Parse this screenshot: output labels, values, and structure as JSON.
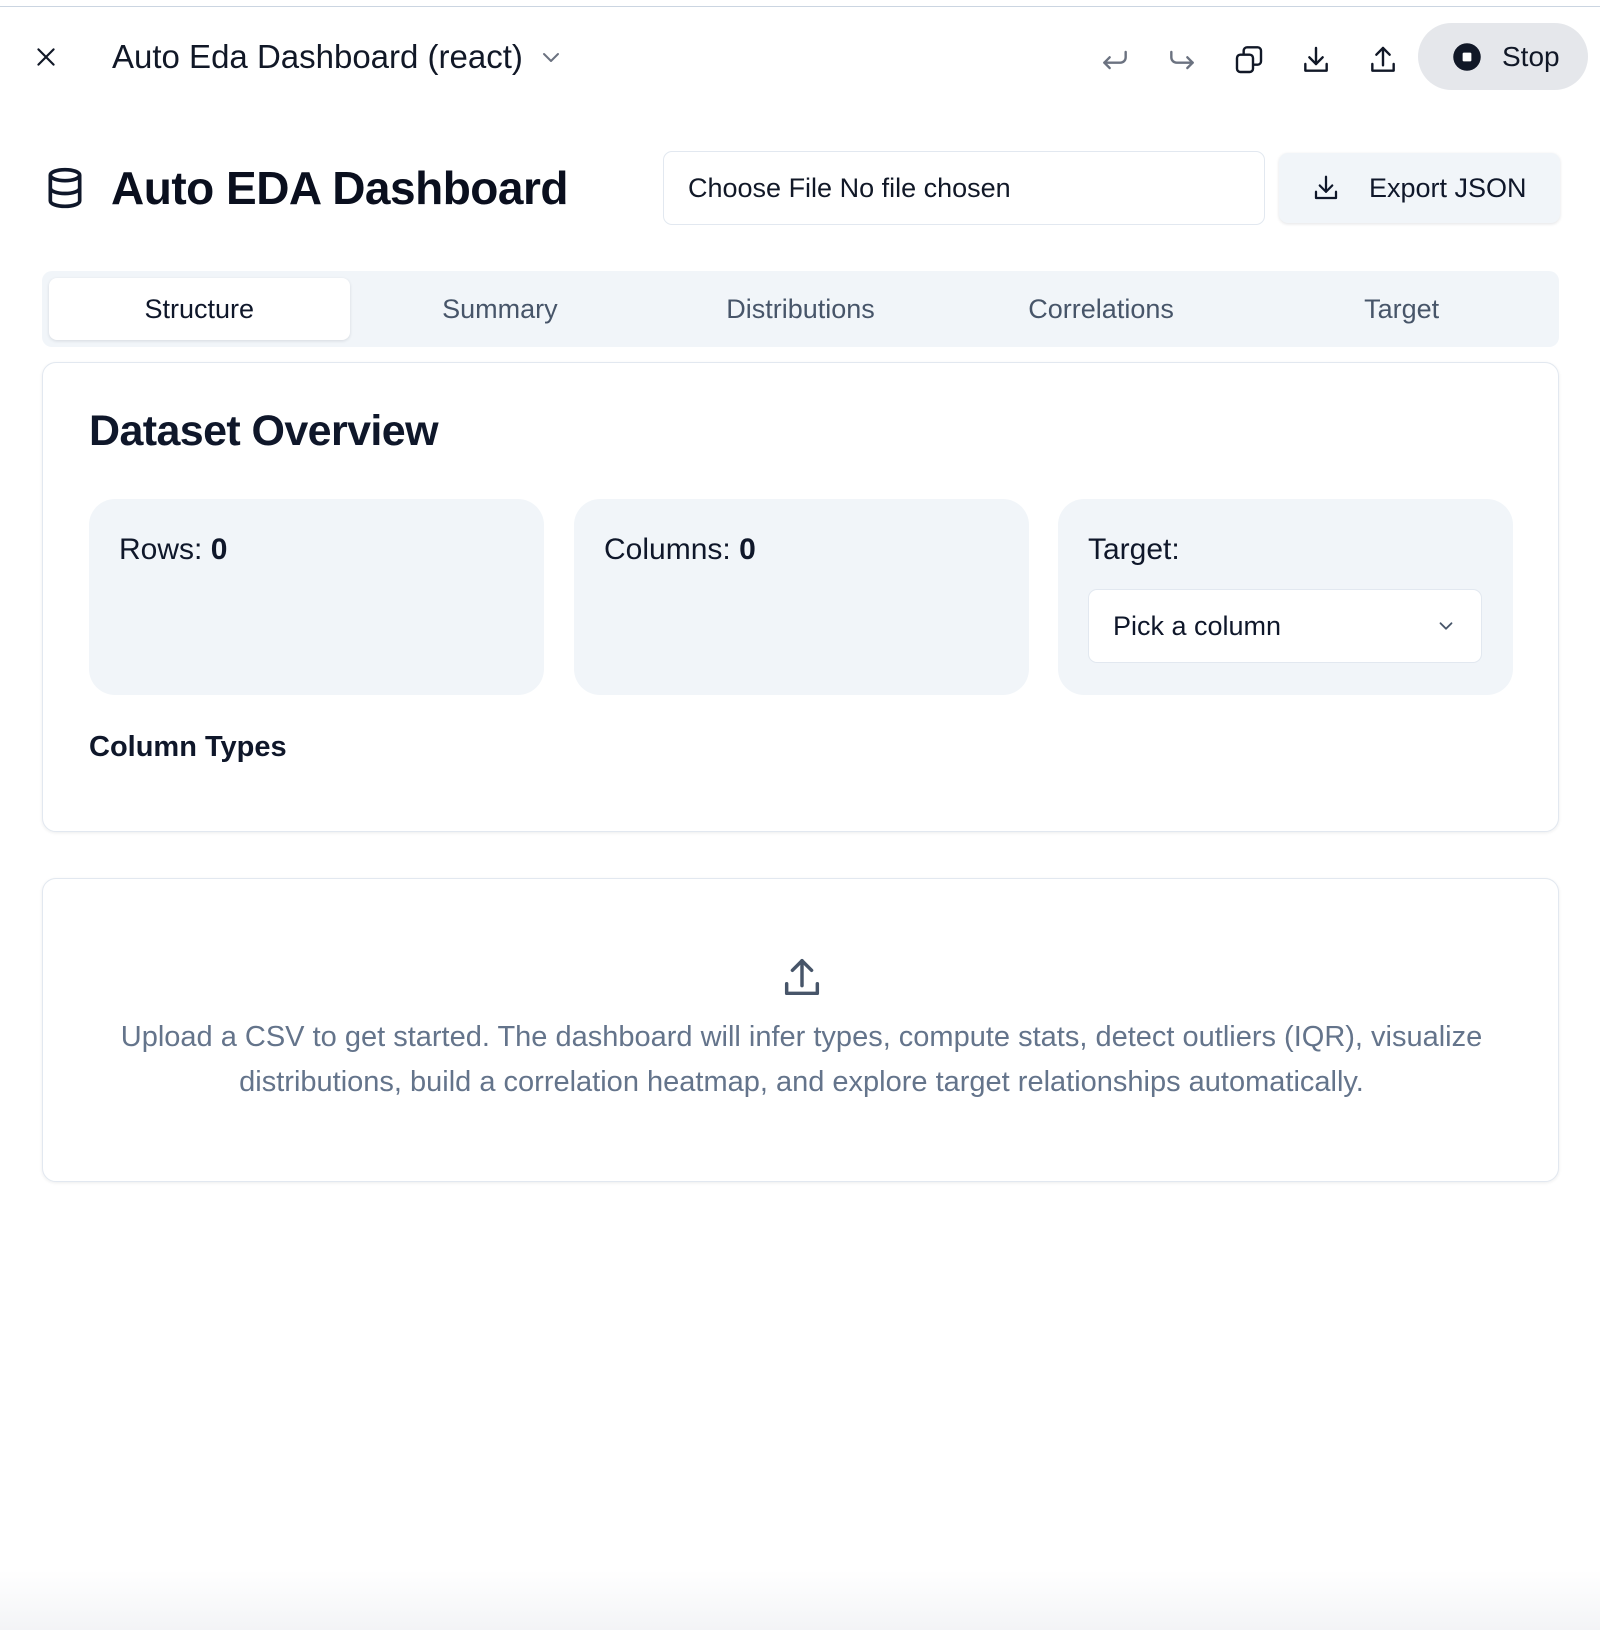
{
  "toolbar": {
    "title": "Auto Eda Dashboard (react)",
    "stop_label": "Stop",
    "icons": [
      "close-icon",
      "chevron-down-icon",
      "undo-icon",
      "redo-icon",
      "duplicate-icon",
      "download-icon",
      "upload-icon",
      "stop-icon"
    ]
  },
  "header": {
    "logo_icon": "database-icon",
    "title": "Auto EDA Dashboard",
    "file_input_text": "Choose File No file chosen",
    "export_label": "Export JSON"
  },
  "tabs": [
    {
      "label": "Structure",
      "active": true
    },
    {
      "label": "Summary",
      "active": false
    },
    {
      "label": "Distributions",
      "active": false
    },
    {
      "label": "Correlations",
      "active": false
    },
    {
      "label": "Target",
      "active": false
    }
  ],
  "overview": {
    "title": "Dataset Overview",
    "rows_label": "Rows:",
    "rows_value": "0",
    "columns_label": "Columns:",
    "columns_value": "0",
    "target_label": "Target:",
    "target_placeholder": "Pick a column",
    "column_types_heading": "Column Types"
  },
  "empty_state": {
    "icon": "upload-icon",
    "message": "Upload a CSV to get started. The dashboard will infer types, compute stats, detect outliers (IQR), visualize distributions, build a correlation heatmap, and explore target relationships automatically."
  },
  "colors": {
    "tab_bar_bg": "#f1f5f9",
    "stat_card_bg": "#f1f5f9",
    "muted_text": "#64748b",
    "stop_button_bg": "#e5e7eb"
  }
}
